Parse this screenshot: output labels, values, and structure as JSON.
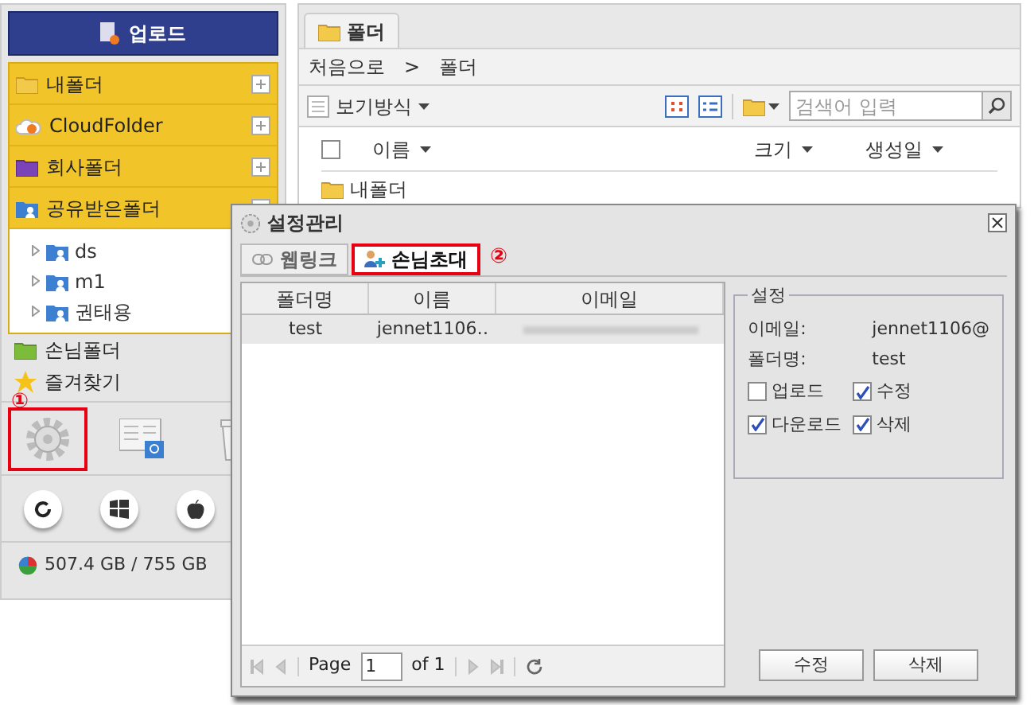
{
  "sidebar": {
    "upload_button": "업로드",
    "folders": [
      {
        "label": "내폴더"
      },
      {
        "label": "CloudFolder"
      },
      {
        "label": "회사폴더"
      },
      {
        "label": "공유받은폴더",
        "expanded": true,
        "children": [
          {
            "label": "ds"
          },
          {
            "label": "m1"
          },
          {
            "label": "권태용"
          }
        ]
      }
    ],
    "extra_items": [
      {
        "label": "손님폴더"
      },
      {
        "label": "즐겨찾기"
      }
    ],
    "tools": [
      {
        "highlighted": true,
        "callout": "①"
      },
      {
        "highlighted": false
      },
      {
        "highlighted": false
      }
    ],
    "storage": "507.4 GB / 755 GB"
  },
  "main": {
    "tab": "폴더",
    "breadcrumb": [
      "처음으로",
      ">",
      "폴더"
    ],
    "view_mode": "보기방식",
    "search": {
      "placeholder": "검색어 입력"
    },
    "select_all_checked": false,
    "columns": [
      "이름",
      "크기",
      "생성일"
    ],
    "rows": [
      {
        "name": "내폴더"
      }
    ]
  },
  "dialog": {
    "title": "설정관리",
    "tabs": [
      {
        "label": "웹링크",
        "selected": false,
        "highlighted": false
      },
      {
        "label": "손님초대",
        "selected": true,
        "highlighted": true,
        "callout": "②"
      }
    ],
    "grid": {
      "columns": [
        "폴더명",
        "이름",
        "이메일"
      ],
      "rows": [
        {
          "cells": [
            "test",
            "jennet1106‥"
          ],
          "email_blurred": true,
          "selected": true
        }
      ]
    },
    "pager": {
      "page_label": "Page",
      "page": "1",
      "of": "of 1"
    },
    "settings": {
      "legend": "설정",
      "fields": [
        {
          "label": "이메일:",
          "value": "jennet1106@"
        },
        {
          "label": "폴더명:",
          "value": "test"
        }
      ],
      "permissions": [
        {
          "label": "업로드",
          "checked": false
        },
        {
          "label": "수정",
          "checked": true
        },
        {
          "label": "다운로드",
          "checked": true
        },
        {
          "label": "삭제",
          "checked": true
        }
      ]
    },
    "buttons": [
      "수정",
      "삭제"
    ]
  }
}
